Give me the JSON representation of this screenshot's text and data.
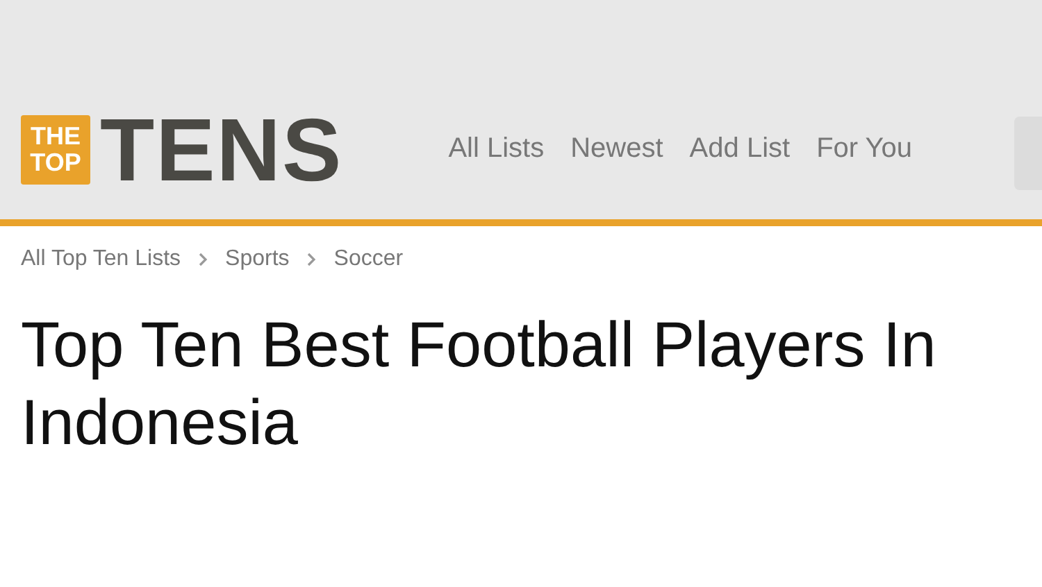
{
  "logo": {
    "badge_lines": [
      "THE",
      "TOP"
    ],
    "wordmark": "TENS"
  },
  "nav": [
    "All Lists",
    "Newest",
    "Add List",
    "For You"
  ],
  "breadcrumb": [
    "All Top Ten Lists",
    "Sports",
    "Soccer"
  ],
  "title": "Top Ten Best Football Players In Indonesia"
}
